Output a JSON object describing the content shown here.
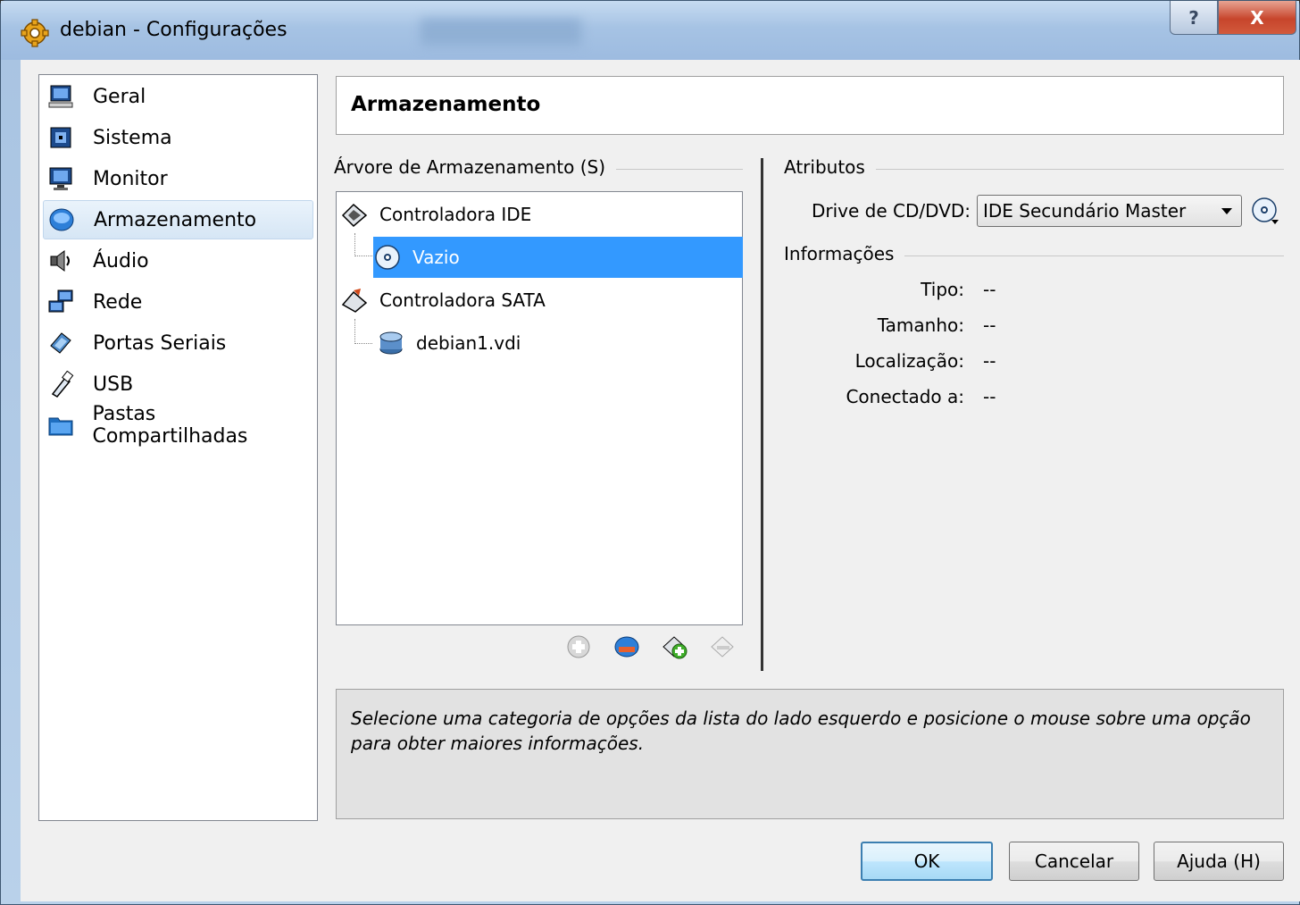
{
  "window": {
    "title": "debian - Configurações",
    "help_label": "?",
    "close_label": "X"
  },
  "sidebar": {
    "items": [
      {
        "label": "Geral",
        "icon": "monitor-computer-icon"
      },
      {
        "label": "Sistema",
        "icon": "chip-icon"
      },
      {
        "label": "Monitor",
        "icon": "display-icon"
      },
      {
        "label": "Armazenamento",
        "icon": "disk-storage-icon",
        "selected": true
      },
      {
        "label": "Áudio",
        "icon": "speaker-icon"
      },
      {
        "label": "Rede",
        "icon": "network-icon"
      },
      {
        "label": "Portas Seriais",
        "icon": "serial-port-icon"
      },
      {
        "label": "USB",
        "icon": "usb-icon"
      },
      {
        "label": "Pastas Compartilhadas",
        "icon": "shared-folder-icon"
      }
    ]
  },
  "header": {
    "title": "Armazenamento"
  },
  "storage_tree": {
    "group_label": "Árvore de Armazenamento (S)",
    "items": [
      {
        "label": "Controladora IDE",
        "icon": "ide-controller-icon",
        "level": 0
      },
      {
        "label": "Vazio",
        "icon": "cd-dvd-icon",
        "level": 1,
        "selected": true
      },
      {
        "label": "Controladora SATA",
        "icon": "sata-controller-icon",
        "level": 0
      },
      {
        "label": "debian1.vdi",
        "icon": "hard-disk-icon",
        "level": 1
      }
    ],
    "tools": [
      "add-attachment-icon",
      "add-controller-icon",
      "add-disk-icon",
      "remove-icon"
    ]
  },
  "attributes": {
    "group_label": "Atributos",
    "drive_label": "Drive de CD/DVD:",
    "drive_value": "IDE Secundário Master"
  },
  "information": {
    "group_label": "Informações",
    "rows": [
      {
        "key": "Tipo:",
        "value": "--"
      },
      {
        "key": "Tamanho:",
        "value": "--"
      },
      {
        "key": "Localização:",
        "value": "--"
      },
      {
        "key": "Conectado a:",
        "value": "--"
      }
    ]
  },
  "description": "Selecione uma categoria de opções da lista do lado esquerdo e posicione o mouse sobre uma opção para obter maiores informações.",
  "buttons": {
    "ok": "OK",
    "cancel": "Cancelar",
    "help": "Ajuda (H)"
  }
}
